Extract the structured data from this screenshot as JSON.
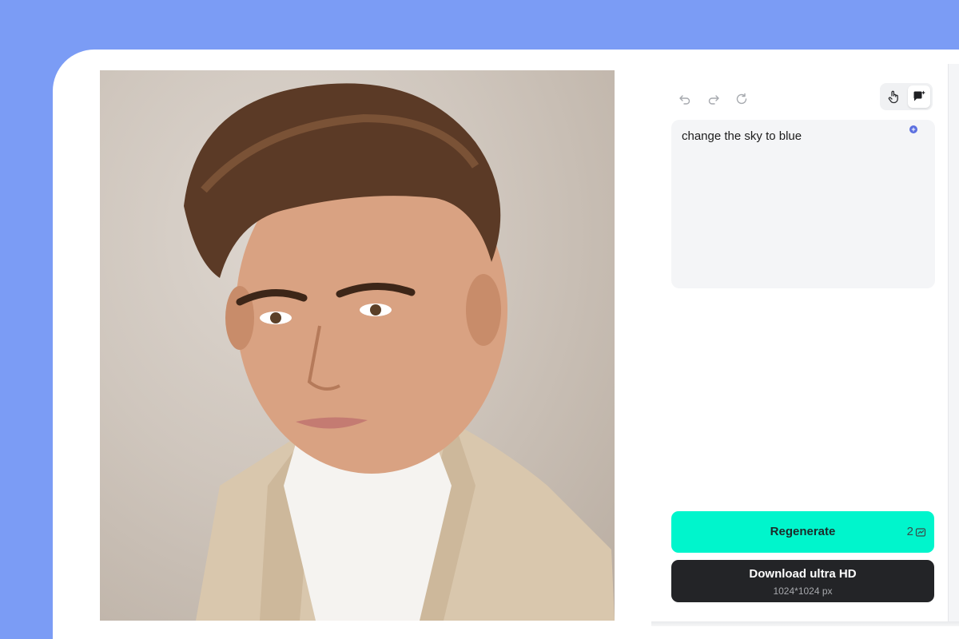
{
  "prompt": {
    "text": "change the sky to blue"
  },
  "toolbar": {
    "undo_icon": "undo-icon",
    "redo_icon": "redo-icon",
    "reset_icon": "refresh-icon",
    "modes": [
      {
        "icon": "hand-pointer-icon",
        "active": false
      },
      {
        "icon": "chat-sparkle-icon",
        "active": true
      }
    ]
  },
  "actions": {
    "regenerate_label": "Regenerate",
    "regenerate_cost": "2",
    "regenerate_cost_icon": "credit-icon",
    "download_label": "Download ultra HD",
    "download_resolution": "1024*1024 px"
  },
  "colors": {
    "page_background": "#7b9cf5",
    "regenerate": "#00f5cc",
    "download": "#232427",
    "prompt_background": "#f4f5f7"
  }
}
